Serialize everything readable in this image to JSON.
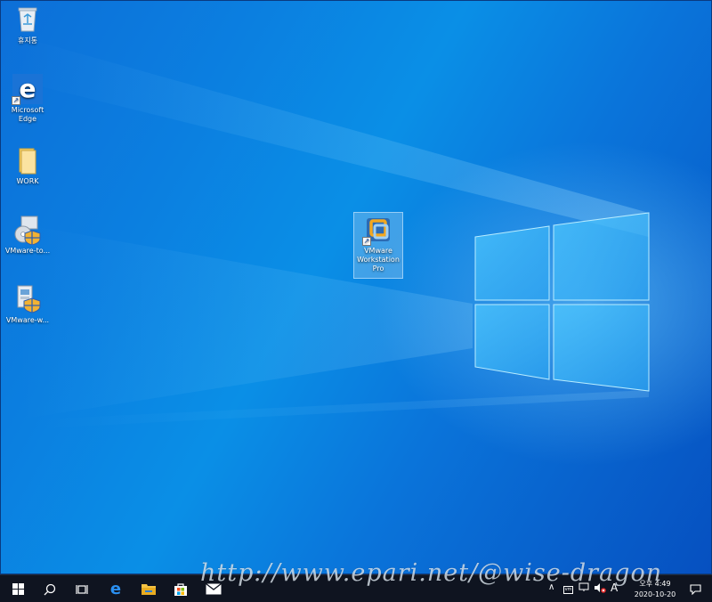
{
  "desktop": {
    "icons": [
      {
        "label": "휴지통",
        "icon": "recycle-bin-icon"
      },
      {
        "label": "Microsoft Edge",
        "icon": "edge-icon"
      },
      {
        "label": "WORK",
        "icon": "folder-icon"
      },
      {
        "label": "VMware-to...",
        "icon": "vmware-tools-installer-icon"
      },
      {
        "label": "VMware-w...",
        "icon": "vmware-workstation-installer-icon"
      },
      {
        "label": "VMware Workstation Pro",
        "icon": "vmware-workstation-icon"
      }
    ]
  },
  "taskbar": {
    "pinned": [
      "start-icon",
      "search-icon",
      "task-view-icon",
      "edge-icon",
      "file-explorer-icon",
      "store-icon",
      "mail-icon"
    ],
    "tray": {
      "input_indicator": "A",
      "time": "오후 4:49",
      "date": "2020-10-20"
    }
  },
  "watermark": "http://www.epari.net/@wise-dragon",
  "colors": {
    "taskbar": "#0f1420",
    "desktop_blue": "#0a8fe6",
    "selection": "#aad2f0"
  }
}
